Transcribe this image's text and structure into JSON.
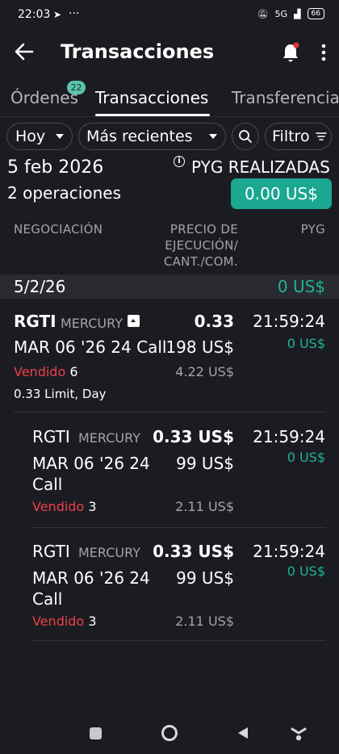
{
  "status": {
    "time": "22:03",
    "network": "5G",
    "battery": "66"
  },
  "header": {
    "title": "Transacciones"
  },
  "tabs": [
    {
      "label": "Órdenes",
      "badge": "22"
    },
    {
      "label": "Transacciones"
    },
    {
      "label": "Transferencia"
    }
  ],
  "filters": {
    "period": "Hoy",
    "sort": "Más recientes",
    "filter": "Filtro"
  },
  "summary": {
    "date": "5 feb 2026",
    "operations": "2 operaciones",
    "pyg_label": "PYG REALIZADAS",
    "pyg_value": "0.00 US$"
  },
  "columns": {
    "negotiation": "NEGOCIACIÓN",
    "price_line1": "PRECIO DE",
    "price_line2": "EJECUCIÓN/",
    "price_line3": "CANT./COM.",
    "pyg": "PYG"
  },
  "group": {
    "date": "5/2/26",
    "pyg": "0 US$"
  },
  "main_trade": {
    "symbol": "RGTI",
    "exchange": "MERCURY",
    "price": "0.33",
    "time": "21:59:24",
    "contract": "MAR 06 '26 24 Call",
    "amount": "198 US$",
    "pyg": "0 US$",
    "side": "Vendido",
    "qty": "6",
    "commission": "4.22 US$",
    "order_type": "0.33 Limit, Day"
  },
  "fills": [
    {
      "symbol": "RGTI",
      "exchange": "MERCURY",
      "price": "0.33 US$",
      "time": "21:59:24",
      "contract_line1": "MAR 06 '26 24",
      "contract_line2": "Call",
      "amount": "99 US$",
      "pyg": "0 US$",
      "side": "Vendido",
      "qty": "3",
      "commission": "2.11 US$"
    },
    {
      "symbol": "RGTI",
      "exchange": "MERCURY",
      "price": "0.33 US$",
      "time": "21:59:24",
      "contract_line1": "MAR 06 '26 24",
      "contract_line2": "Call",
      "amount": "99 US$",
      "pyg": "0 US$",
      "side": "Vendido",
      "qty": "3",
      "commission": "2.11 US$"
    }
  ]
}
